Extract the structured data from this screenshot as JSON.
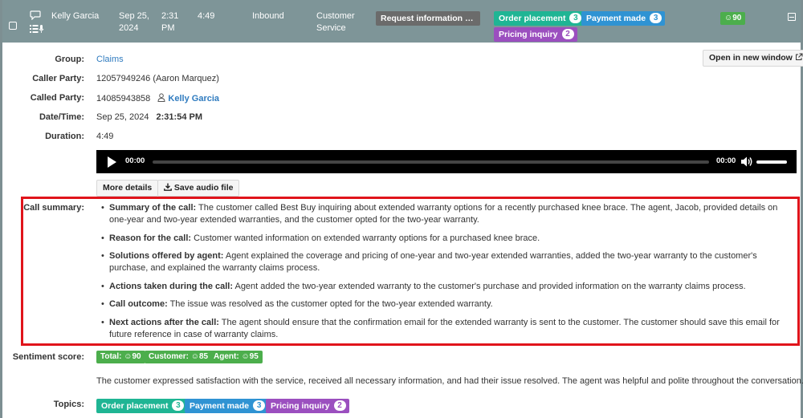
{
  "header": {
    "agent": "Kelly Garcia",
    "date_line1": "Sep 25,",
    "date_line2": "2024",
    "time_line1": "2:31",
    "time_line2": "PM",
    "duration": "4:49",
    "direction": "Inbound",
    "dept_line1": "Customer",
    "dept_line2": "Service",
    "subject": "Request information abou...",
    "score": "☺90"
  },
  "topics": [
    {
      "label": "Order placement",
      "count": "3",
      "color": "#1fb594"
    },
    {
      "label": "Payment made",
      "count": "3",
      "color": "#2f93d3"
    },
    {
      "label": "Pricing inquiry",
      "count": "2",
      "color": "#9b4fbf"
    }
  ],
  "details": {
    "group_label": "Group:",
    "group_value": "Claims",
    "open_button": "Open in new window",
    "caller_label": "Caller Party:",
    "caller_value": "12057949246 (Aaron Marquez)",
    "called_label": "Called Party:",
    "called_number": "14085943858",
    "called_name": "Kelly Garcia",
    "datetime_label": "Date/Time:",
    "datetime_date": "Sep 25, 2024",
    "datetime_time": "2:31:54 PM",
    "duration_label": "Duration:",
    "duration_value": "4:49"
  },
  "player": {
    "current": "00:00",
    "total": "00:00"
  },
  "buttons": {
    "more_details": "More details",
    "save_audio": "Save audio file"
  },
  "summary": {
    "label": "Call summary:",
    "items": [
      {
        "title": "Summary of the call:",
        "text": " The customer called Best Buy inquiring about extended warranty options for a recently purchased knee brace. The agent, Jacob, provided details on one-year and two-year extended warranties, and the customer opted for the two-year warranty."
      },
      {
        "title": "Reason for the call:",
        "text": " Customer wanted information on extended warranty options for a purchased knee brace."
      },
      {
        "title": "Solutions offered by agent:",
        "text": " Agent explained the coverage and pricing of one-year and two-year extended warranties, added the two-year warranty to the customer's purchase, and explained the warranty claims process."
      },
      {
        "title": "Actions taken during the call:",
        "text": " Agent added the two-year extended warranty to the customer's purchase and provided information on the warranty claims process."
      },
      {
        "title": "Call outcome:",
        "text": " The issue was resolved as the customer opted for the two-year extended warranty."
      },
      {
        "title": "Next actions after the call:",
        "text": " The agent should ensure that the confirmation email for the extended warranty is sent to the customer. The customer should save this email for future reference in case of warranty claims."
      }
    ]
  },
  "sentiment": {
    "label": "Sentiment score:",
    "total": "Total: ☺90",
    "customer": "Customer: ☺85",
    "agent": "Agent: ☺95",
    "note": "The customer expressed satisfaction with the service, received all necessary information, and had their issue resolved. The agent was helpful and polite throughout the conversation."
  },
  "topics_label": "Topics:",
  "colors": {
    "header_bg": "#7e9598",
    "highlight_border": "#e0141b",
    "score_green": "#4cae4c",
    "link_blue": "#2f7bbf"
  }
}
